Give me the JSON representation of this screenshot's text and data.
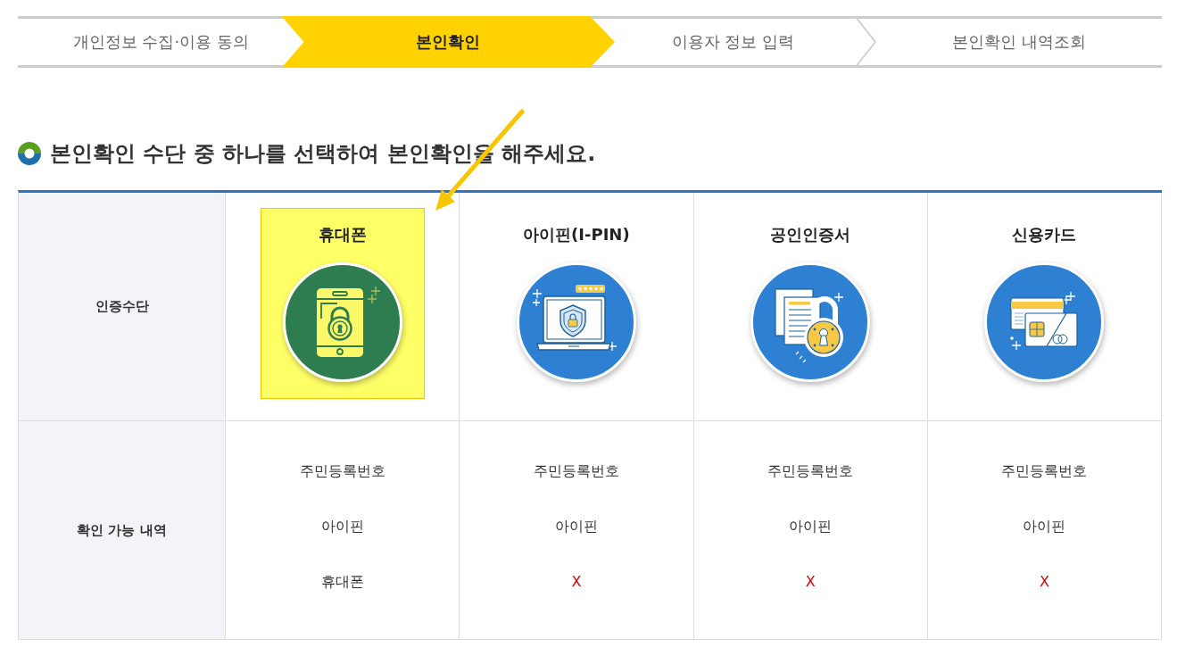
{
  "steps": [
    {
      "label": "개인정보 수집·이용 동의",
      "selected": false
    },
    {
      "label": "본인확인",
      "selected": true
    },
    {
      "label": "이용자 정보 입력",
      "selected": false
    },
    {
      "label": "본인확인 내역조회",
      "selected": false
    }
  ],
  "heading": "본인확인 수단 중 하나를 선택하여 본인확인을 해주세요.",
  "table": {
    "method_row": {
      "header": "인증수단",
      "methods": [
        {
          "label": "휴대폰",
          "kind": "phone",
          "selected": true
        },
        {
          "label": "아이핀(I-PIN)",
          "kind": "ipin",
          "selected": false
        },
        {
          "label": "공인인증서",
          "kind": "certificate",
          "selected": false
        },
        {
          "label": "신용카드",
          "kind": "card",
          "selected": false
        }
      ]
    },
    "coverage_row": {
      "header": "확인 가능 내역",
      "columns": [
        {
          "items": [
            {
              "text": "주민등록번호",
              "kind": "available"
            },
            {
              "text": "아이핀",
              "kind": "available"
            },
            {
              "text": "휴대폰",
              "kind": "available"
            }
          ]
        },
        {
          "items": [
            {
              "text": "주민등록번호",
              "kind": "available"
            },
            {
              "text": "아이핀",
              "kind": "available"
            },
            {
              "text": "X",
              "kind": "unavailable"
            }
          ]
        },
        {
          "items": [
            {
              "text": "주민등록번호",
              "kind": "available"
            },
            {
              "text": "아이핀",
              "kind": "available"
            },
            {
              "text": "X",
              "kind": "unavailable"
            }
          ]
        },
        {
          "items": [
            {
              "text": "주민등록번호",
              "kind": "available"
            },
            {
              "text": "아이핀",
              "kind": "available"
            },
            {
              "text": "X",
              "kind": "unavailable"
            }
          ]
        }
      ]
    }
  }
}
